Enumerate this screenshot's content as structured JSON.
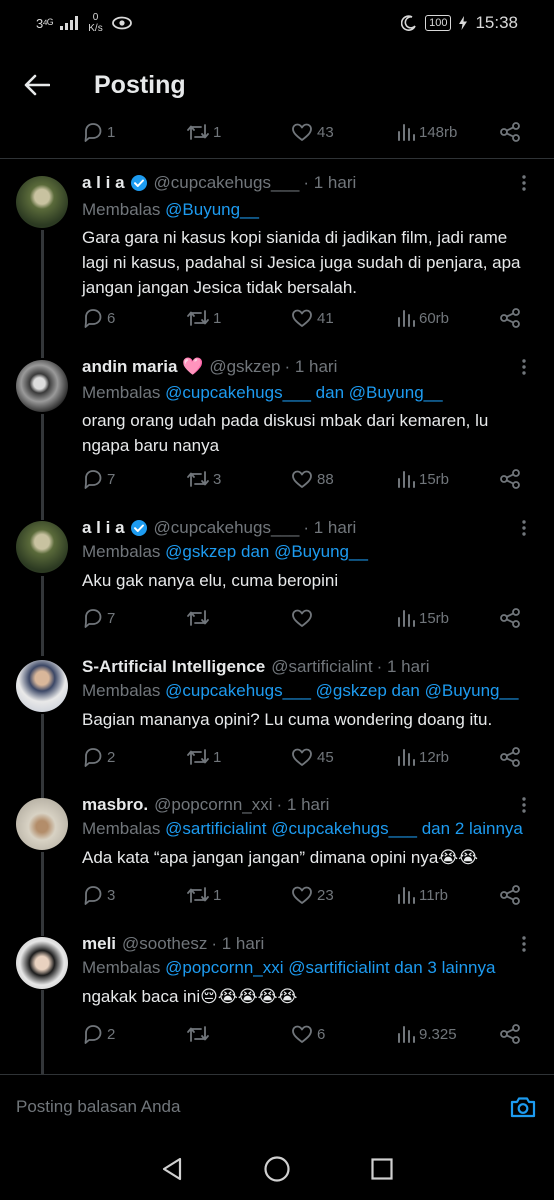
{
  "status_bar": {
    "signal": "3⁴ᴳ",
    "speed_value": "0",
    "speed_unit": "K/s",
    "battery": "100",
    "time": "15:38"
  },
  "header": {
    "title": "Posting"
  },
  "top_actions": {
    "replies": "1",
    "reposts": "1",
    "likes": "43",
    "views": "148rb"
  },
  "tweets": [
    {
      "name": "a l i a",
      "verified": true,
      "handle": "@cupcakehugs___",
      "time": "· 1 hari",
      "reply_prefix": "Membalas ",
      "reply_mentions": "@Buyung__",
      "text": "Gara gara ni kasus kopi sianida di jadikan film, jadi rame lagi ni kasus, padahal si Jesica juga sudah di penjara, apa jangan jangan Jesica tidak bersalah.",
      "replies": "6",
      "reposts": "1",
      "likes": "41",
      "views": "60rb"
    },
    {
      "name": "andin maria 🩷",
      "verified": false,
      "handle": "@gskzep",
      "time": "· 1 hari",
      "reply_prefix": "Membalas ",
      "reply_mentions": "@cupcakehugs___ dan @Buyung__",
      "text": "orang orang udah pada diskusi mbak dari kemaren, lu ngapa baru nanya",
      "replies": "7",
      "reposts": "3",
      "likes": "88",
      "views": "15rb"
    },
    {
      "name": "a l i a",
      "verified": true,
      "handle": "@cupcakehugs___",
      "time": "· 1 hari",
      "reply_prefix": "Membalas ",
      "reply_mentions": "@gskzep dan @Buyung__",
      "text": "Aku gak nanya elu, cuma beropini",
      "replies": "7",
      "reposts": "",
      "likes": "",
      "views": "15rb"
    },
    {
      "name": "S-Artificial Intelligence",
      "verified": false,
      "handle": "@sartificialint",
      "time": "· 1 hari",
      "reply_prefix": "Membalas ",
      "reply_mentions": "@cupcakehugs___ @gskzep dan @Buyung__",
      "text": "Bagian mananya opini? Lu cuma wondering doang itu.",
      "replies": "2",
      "reposts": "1",
      "likes": "45",
      "views": "12rb"
    },
    {
      "name": "masbro.",
      "verified": false,
      "handle": "@popcornn_xxi",
      "time": "· 1 hari",
      "reply_prefix": "Membalas ",
      "reply_mentions": "@sartificialint @cupcakehugs___ dan 2 lainnya",
      "text": "Ada kata “apa jangan jangan” dimana opini nya😭😭",
      "replies": "3",
      "reposts": "1",
      "likes": "23",
      "views": "11rb"
    },
    {
      "name": "meli",
      "verified": false,
      "handle": "@soothesz",
      "time": "· 1 hari",
      "reply_prefix": "Membalas ",
      "reply_mentions": "@popcornn_xxi @sartificialint dan 3 lainnya",
      "text": "ngakak baca ini😔😭😭😭😭",
      "replies": "2",
      "reposts": "",
      "likes": "6",
      "views": "9.325"
    }
  ],
  "compose": {
    "placeholder": "Posting balasan Anda"
  },
  "colors": {
    "accent": "#1d9bf0",
    "muted": "#71767b",
    "text": "#e7e9ea",
    "bg": "#000000"
  },
  "icons": [
    "back-arrow-icon",
    "reply-icon",
    "repost-icon",
    "like-icon",
    "views-icon",
    "share-icon",
    "more-icon",
    "verified-icon",
    "camera-icon",
    "nav-back-icon",
    "nav-home-icon",
    "nav-recents-icon"
  ]
}
